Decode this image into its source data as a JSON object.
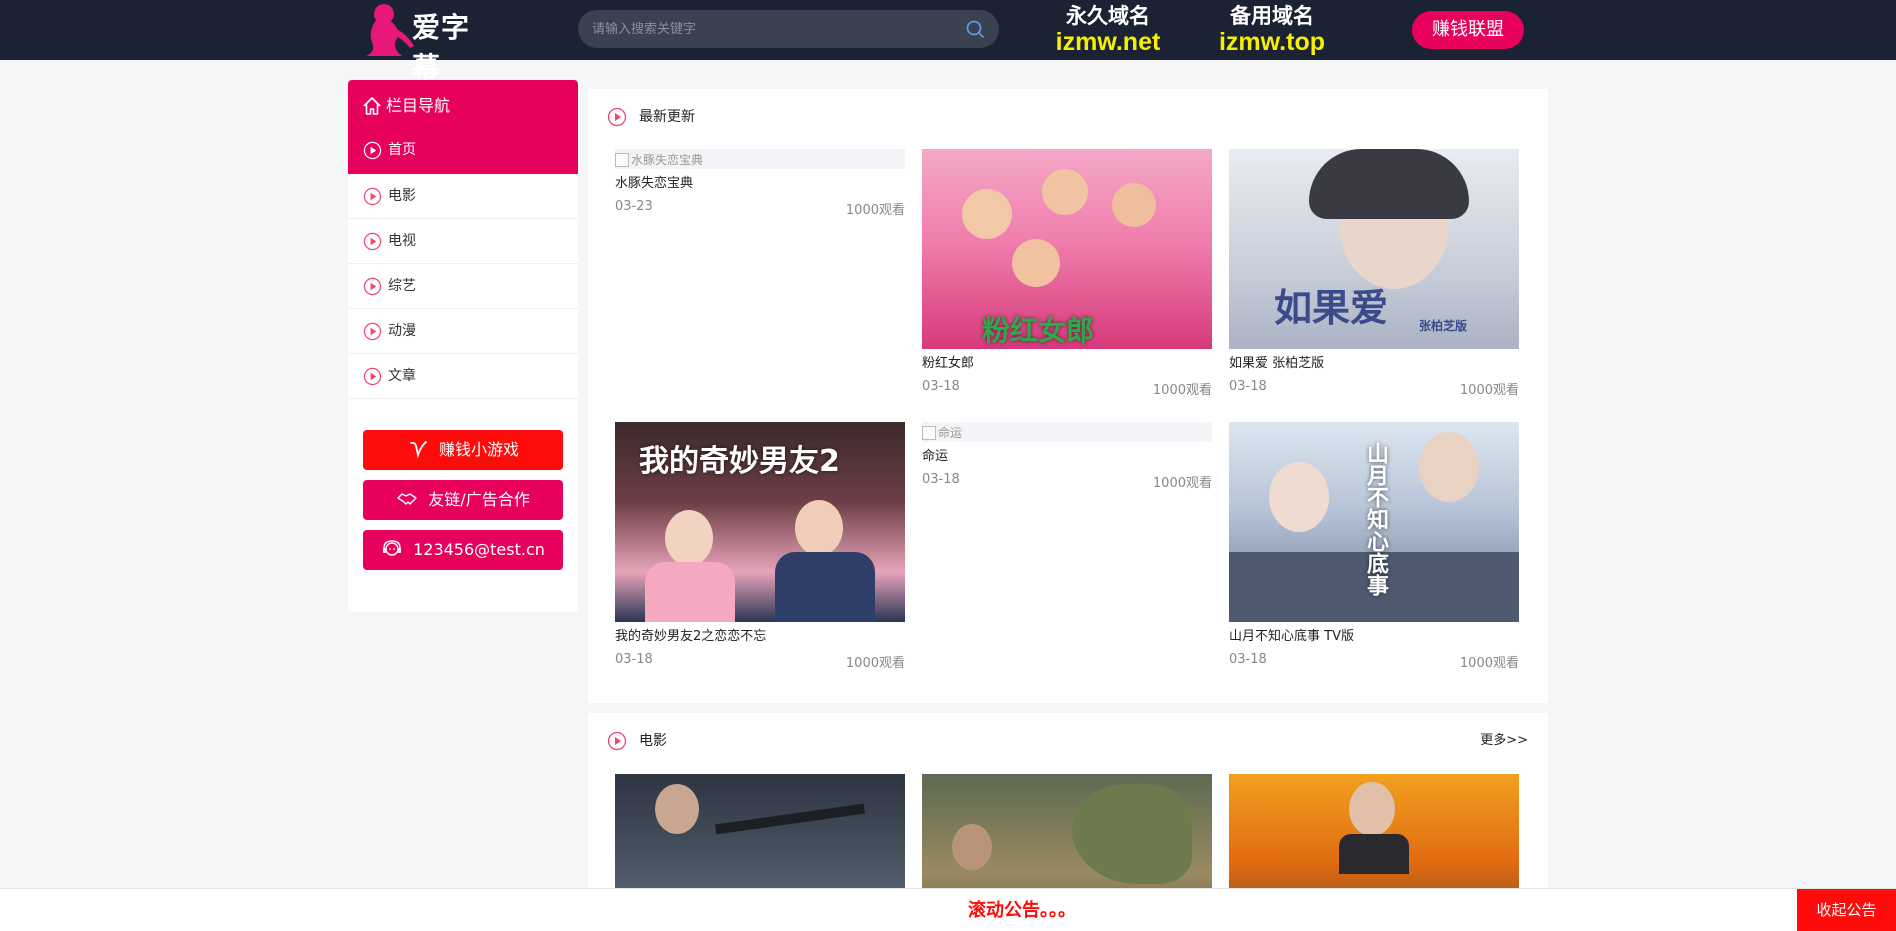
{
  "header": {
    "logo_text": "爱字幕",
    "search_placeholder": "请输入搜索关键字",
    "domains": [
      {
        "label": "永久域名",
        "value": "izmw.net"
      },
      {
        "label": "备用域名",
        "value": "izmw.top"
      }
    ],
    "earn_button": "赚钱联盟"
  },
  "sidebar": {
    "title": "栏目导航",
    "items": [
      {
        "label": "首页",
        "active": true
      },
      {
        "label": "电影",
        "active": false
      },
      {
        "label": "电视",
        "active": false
      },
      {
        "label": "综艺",
        "active": false
      },
      {
        "label": "动漫",
        "active": false
      },
      {
        "label": "文章",
        "active": false
      }
    ],
    "buttons": [
      {
        "label": "赚钱小游戏",
        "icon": "v-icon",
        "color": "#ff0b0b"
      },
      {
        "label": "友链/广告合作",
        "icon": "handshake-icon",
        "color": "#e8005d"
      },
      {
        "label": "123456@test.cn",
        "icon": "support-icon",
        "color": "#e8005d"
      }
    ]
  },
  "latest": {
    "title": "最新更新",
    "cards": [
      {
        "title": "水豚失恋宝典",
        "alt": "水豚失恋宝典",
        "date": "03-23",
        "views": "1000观看",
        "image_loaded": false
      },
      {
        "title": "粉红女郎",
        "poster_text": "粉红女郎",
        "date": "03-18",
        "views": "1000观看",
        "image_loaded": true
      },
      {
        "title": "如果爱 张柏芝版",
        "poster_text": "如果爱",
        "poster_subtext": "张柏芝版",
        "date": "03-18",
        "views": "1000观看",
        "image_loaded": true
      },
      {
        "title": "我的奇妙男友2之恋恋不忘",
        "poster_text": "我的奇妙男友2",
        "date": "03-18",
        "views": "1000观看",
        "image_loaded": true
      },
      {
        "title": "命运",
        "alt": "命运",
        "date": "03-18",
        "views": "1000观看",
        "image_loaded": false
      },
      {
        "title": "山月不知心底事 TV版",
        "poster_text": "山月不知心底事",
        "date": "03-18",
        "views": "1000观看",
        "image_loaded": true
      }
    ]
  },
  "movies": {
    "title": "电影",
    "more": "更多>>"
  },
  "notice": {
    "text": "滚动公告。。。",
    "collapse": "收起公告"
  },
  "colors": {
    "header_bg": "#1a2233",
    "accent_pink": "#e8005d",
    "accent_red": "#ff0b0b",
    "domain_yellow": "#f5f000"
  }
}
